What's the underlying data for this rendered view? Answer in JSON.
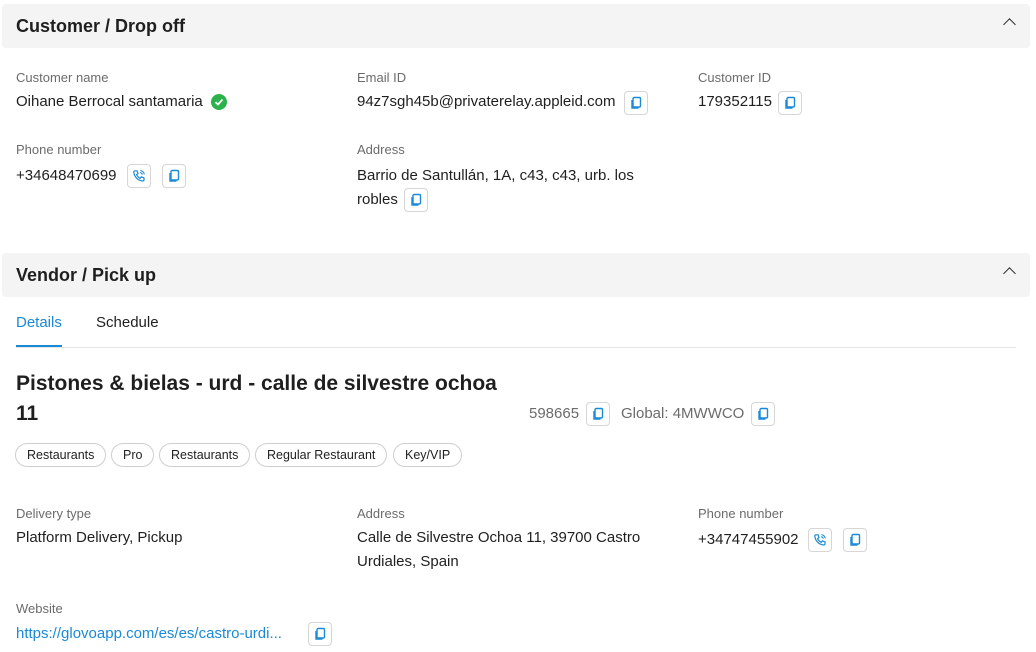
{
  "customer": {
    "section_title": "Customer / Drop off",
    "name_label": "Customer name",
    "name": "Oihane Berrocal santamaria",
    "email_label": "Email ID",
    "email": "94z7sgh45b@privaterelay.appleid.com",
    "id_label": "Customer ID",
    "id": "179352115",
    "phone_label": "Phone number",
    "phone": "+34648470699",
    "address_label": "Address",
    "address_line1": "Barrio de Santullán, 1A, c43, c43, urb. los",
    "address_line2": "robles"
  },
  "vendor": {
    "section_title": "Vendor / Pick up",
    "tabs": [
      {
        "label": "Details",
        "active": true
      },
      {
        "label": "Schedule",
        "active": false
      }
    ],
    "name_line1": "Pistones & bielas - urd - calle de silvestre ochoa",
    "name_line2": "11",
    "store_id": "598665",
    "global_id": "Global: 4MWWCO",
    "tags": [
      "Restaurants",
      "Pro",
      "Restaurants",
      "Regular Restaurant",
      "Key/VIP"
    ],
    "delivery_type_label": "Delivery type",
    "delivery_type": "Platform Delivery, Pickup",
    "address_label": "Address",
    "address_line1": "Calle de Silvestre Ochoa 11, 39700 Castro",
    "address_line2": "Urdiales, Spain",
    "phone_label": "Phone number",
    "phone": "+34747455902",
    "website_label": "Website",
    "website": "https://glovoapp.com/es/es/castro-urdi..."
  },
  "colors": {
    "accent": "#1a8ad6",
    "verified": "#2bb24c",
    "header_bg": "#f4f4f4"
  },
  "icons": [
    "chevron-up-icon",
    "verified-check-icon",
    "copy-icon",
    "phone-call-icon"
  ]
}
